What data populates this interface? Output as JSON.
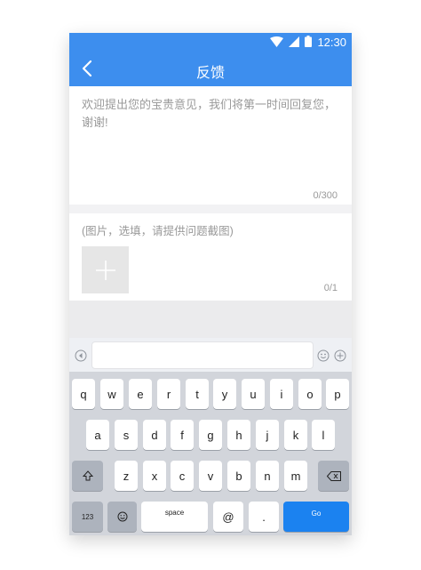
{
  "status_bar": {
    "time": "12:30"
  },
  "nav": {
    "title": "反馈"
  },
  "feedback": {
    "placeholder": "欢迎提出您的宝贵意见，我们将第一时间回复您，谢谢!",
    "counter": "0/300"
  },
  "attachments": {
    "placeholder": "(图片，选填，请提供问题截图)",
    "counter": "0/1"
  },
  "keyboard": {
    "row1": [
      "q",
      "w",
      "e",
      "r",
      "t",
      "y",
      "u",
      "i",
      "o",
      "p"
    ],
    "row2": [
      "a",
      "s",
      "d",
      "f",
      "g",
      "h",
      "j",
      "k",
      "l"
    ],
    "row3": [
      "z",
      "x",
      "c",
      "v",
      "b",
      "n",
      "m"
    ],
    "numbers_key": "123",
    "space_key": "space",
    "at_key": "@",
    "dot_key": ".",
    "go_key": "Go"
  },
  "colors": {
    "primary": "#3d8eee",
    "go_key": "#1b82f0"
  }
}
